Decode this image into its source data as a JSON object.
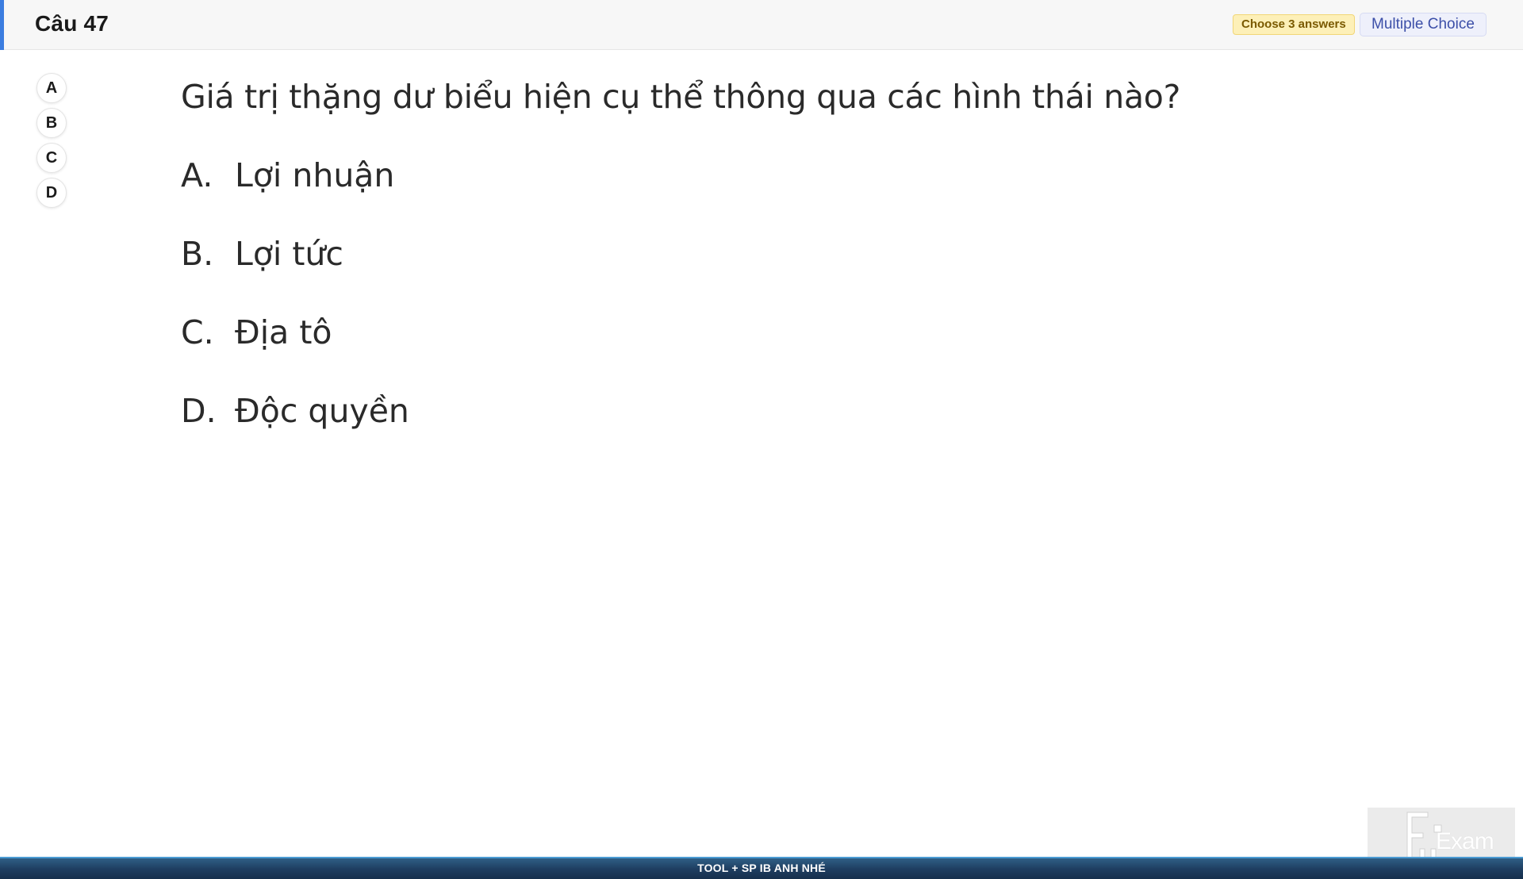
{
  "header": {
    "question_number": "Câu 47",
    "badge_choose": "Choose 3 answers",
    "badge_type": "Multiple Choice"
  },
  "selector": {
    "options": [
      "A",
      "B",
      "C",
      "D"
    ]
  },
  "question": {
    "text": "Giá trị thặng dư biểu hiện cụ thể thông qua các hình thái nào?",
    "options": [
      {
        "letter": "A.",
        "text": "Lợi nhuận"
      },
      {
        "letter": "B.",
        "text": "Lợi tức"
      },
      {
        "letter": "C.",
        "text": "Địa tô"
      },
      {
        "letter": "D.",
        "text": "Độc quyền"
      }
    ]
  },
  "footer": {
    "text": "TOOL + SP IB ANH NHÉ"
  },
  "logo": {
    "word": "Exam"
  },
  "colors": {
    "accent": "#3b7de0",
    "badge_choose_bg": "#fdf0b8",
    "badge_type_text": "#3c4fa8",
    "footer_bg": "#1f3f62"
  }
}
